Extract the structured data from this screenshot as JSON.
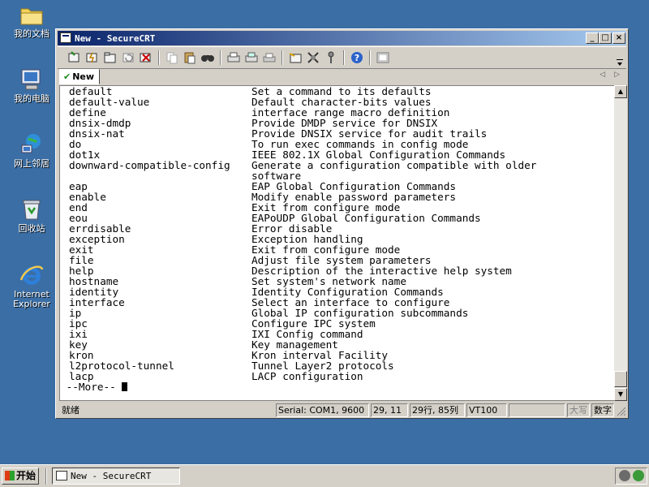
{
  "desktop": {
    "icons": [
      {
        "label": "我的文档",
        "icon": "my-documents-folder-icon"
      },
      {
        "label": "我的电脑",
        "icon": "my-computer-icon"
      },
      {
        "label": "网上邻居",
        "icon": "network-places-icon"
      },
      {
        "label": "回收站",
        "icon": "recycle-bin-icon"
      },
      {
        "label_lines": [
          "Internet",
          "Explorer"
        ],
        "icon": "internet-explorer-icon"
      }
    ]
  },
  "window": {
    "title": "New - SecureCRT",
    "controls": {
      "minimize": "_",
      "maximize": "□",
      "close": "×"
    }
  },
  "toolbar": {
    "buttons": [
      "connect-icon",
      "quick-connect-icon",
      "connect-in-tab-icon",
      "reconnect-icon",
      "disconnect-icon",
      "copy-icon",
      "paste-icon",
      "find-icon",
      "print-icon",
      "print-selection-icon",
      "print-setup-icon",
      "session-options-icon",
      "global-options-icon",
      "keymap-icon",
      "help-icon",
      "sftp-icon"
    ]
  },
  "tabs": [
    {
      "label": "New",
      "active": true,
      "status_icon": "connected-check-icon"
    }
  ],
  "tab_nav": {
    "prev": "◁",
    "next": "▷"
  },
  "terminal": {
    "lines": [
      {
        "cmd": "default",
        "desc": "Set a command to its defaults"
      },
      {
        "cmd": "default-value",
        "desc": "Default character-bits values"
      },
      {
        "cmd": "define",
        "desc": "interface range macro definition"
      },
      {
        "cmd": "dnsix-dmdp",
        "desc": "Provide DMDP service for DNSIX"
      },
      {
        "cmd": "dnsix-nat",
        "desc": "Provide DNSIX service for audit trails"
      },
      {
        "cmd": "do",
        "desc": "To run exec commands in config mode"
      },
      {
        "cmd": "dot1x",
        "desc": "IEEE 802.1X Global Configuration Commands"
      },
      {
        "cmd": "downward-compatible-config",
        "desc": "Generate a configuration compatible with older"
      },
      {
        "cmd": "",
        "desc": "software"
      },
      {
        "cmd": "eap",
        "desc": "EAP Global Configuration Commands"
      },
      {
        "cmd": "enable",
        "desc": "Modify enable password parameters"
      },
      {
        "cmd": "end",
        "desc": "Exit from configure mode"
      },
      {
        "cmd": "eou",
        "desc": "EAPoUDP Global Configuration Commands"
      },
      {
        "cmd": "errdisable",
        "desc": "Error disable"
      },
      {
        "cmd": "exception",
        "desc": "Exception handling"
      },
      {
        "cmd": "exit",
        "desc": "Exit from configure mode"
      },
      {
        "cmd": "file",
        "desc": "Adjust file system parameters"
      },
      {
        "cmd": "help",
        "desc": "Description of the interactive help system"
      },
      {
        "cmd": "hostname",
        "desc": "Set system's network name"
      },
      {
        "cmd": "identity",
        "desc": "Identity Configuration Commands"
      },
      {
        "cmd": "interface",
        "desc": "Select an interface to configure"
      },
      {
        "cmd": "ip",
        "desc": "Global IP configuration subcommands"
      },
      {
        "cmd": "ipc",
        "desc": "Configure IPC system"
      },
      {
        "cmd": "ixi",
        "desc": "IXI Config command"
      },
      {
        "cmd": "key",
        "desc": "Key management"
      },
      {
        "cmd": "kron",
        "desc": "Kron interval Facility"
      },
      {
        "cmd": "l2protocol-tunnel",
        "desc": "Tunnel Layer2 protocols"
      },
      {
        "cmd": "lacp",
        "desc": "LACP configuration"
      }
    ],
    "more_prompt": " --More-- "
  },
  "scrollbar": {
    "up": "▲",
    "down": "▼"
  },
  "statusbar": {
    "ready": "就绪",
    "serial": "Serial: COM1, 9600",
    "cursor_pos": "29, 11",
    "rows_cols": "29行, 85列",
    "emulation": "VT100",
    "blank": "",
    "caps": "大写",
    "num": "数字"
  },
  "taskbar": {
    "start_label": "开始",
    "task_title": "New - SecureCRT",
    "tray_icons": [
      "network-tray-icon",
      "volume-tray-icon"
    ]
  }
}
